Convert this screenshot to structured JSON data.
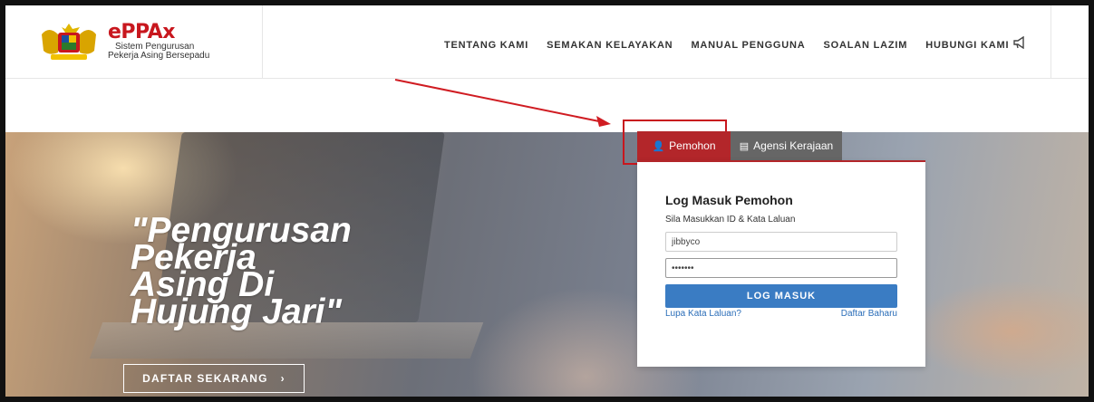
{
  "brand": {
    "logo_text": "ePPAx",
    "tagline_line1": "Sistem Pengurusan",
    "tagline_line2": "Pekerja Asing Bersepadu"
  },
  "nav": {
    "items": [
      {
        "label": "TENTANG KAMI"
      },
      {
        "label": "SEMAKAN KELAYAKAN"
      },
      {
        "label": "MANUAL PENGGUNA"
      },
      {
        "label": "SOALAN LAZIM"
      },
      {
        "label": "HUBUNGI KAMI"
      }
    ],
    "announcement_icon": "megaphone-icon"
  },
  "hero": {
    "slogan_lines": [
      "\"Pengurusan",
      "Pekerja",
      "Asing Di",
      "Hujung Jari\""
    ],
    "cta_label": "DAFTAR SEKARANG",
    "cta_icon": "chevron-right-icon"
  },
  "tabs": [
    {
      "label": "Pemohon",
      "icon": "user-icon",
      "active": true
    },
    {
      "label": "Agensi Kerajaan",
      "icon": "building-icon",
      "active": false
    }
  ],
  "login": {
    "title": "Log Masuk Pemohon",
    "subtitle": "Sila Masukkan ID & Kata Laluan",
    "username_value": "jibbyco",
    "password_value": "•••••••",
    "submit_label": "LOG MASUK",
    "forgot_label": "Lupa Kata Laluan?",
    "register_label": "Daftar Baharu"
  },
  "colors": {
    "accent_red": "#b3262a",
    "button_blue": "#3a7cc3",
    "annotation_red": "#c8171e"
  }
}
